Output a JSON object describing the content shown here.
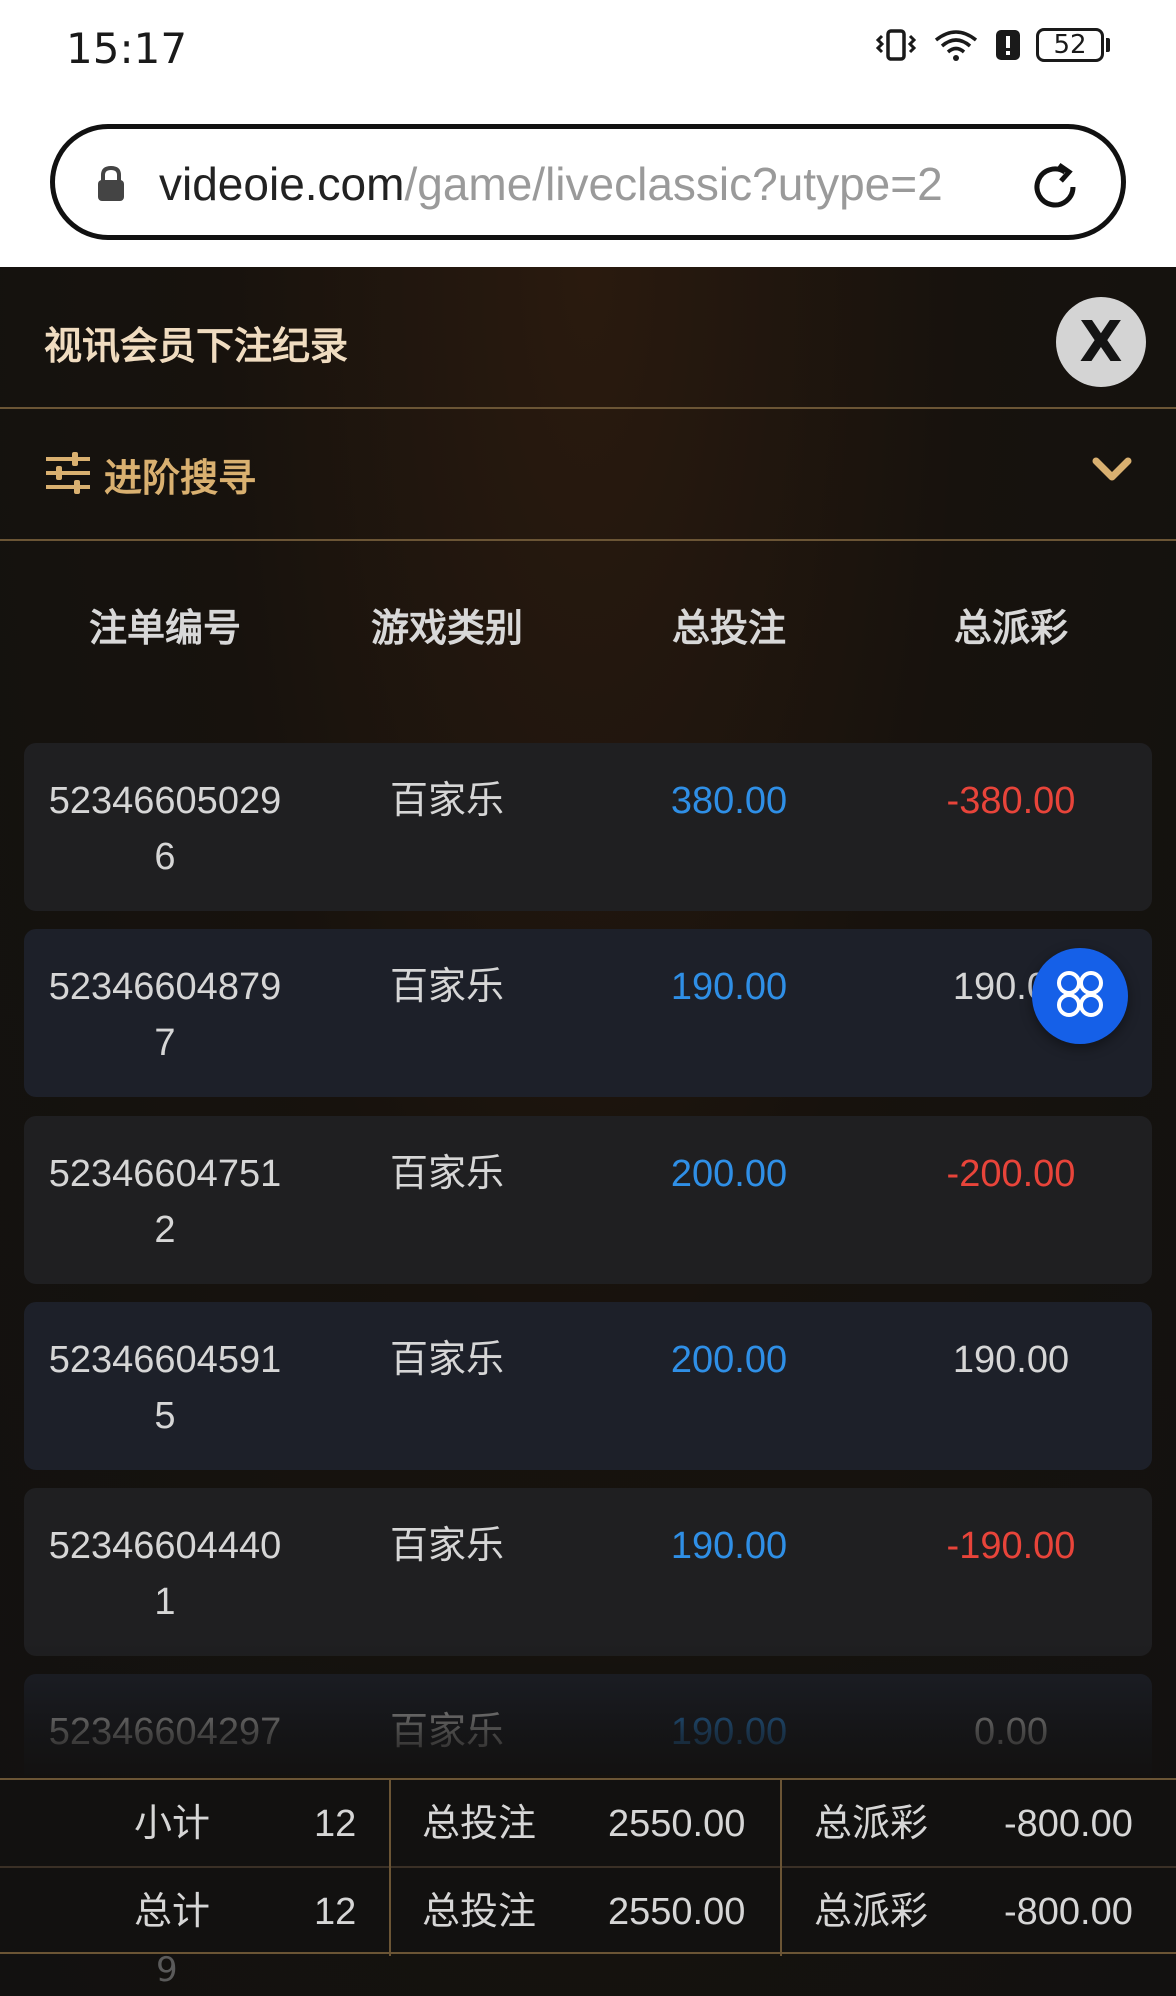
{
  "status_bar": {
    "time": "15:17",
    "battery": "52"
  },
  "browser": {
    "url_host": "videoie.com",
    "url_path": "/game/liveclassic?utype=2"
  },
  "panel": {
    "title": "视讯会员下注纪录",
    "close_label": "X",
    "advanced_search_label": "进阶搜寻"
  },
  "table": {
    "headers": [
      "注单编号",
      "游戏类别",
      "总投注",
      "总派彩"
    ],
    "rows": [
      {
        "id_line1": "52346605029",
        "id_line2": "6",
        "game": "百家乐",
        "bet": "380.00",
        "payout": "-380.00"
      },
      {
        "id_line1": "52346604879",
        "id_line2": "7",
        "game": "百家乐",
        "bet": "190.00",
        "payout": "190.00"
      },
      {
        "id_line1": "52346604751",
        "id_line2": "2",
        "game": "百家乐",
        "bet": "200.00",
        "payout": "-200.00"
      },
      {
        "id_line1": "52346604591",
        "id_line2": "5",
        "game": "百家乐",
        "bet": "200.00",
        "payout": "190.00"
      },
      {
        "id_line1": "52346604440",
        "id_line2": "1",
        "game": "百家乐",
        "bet": "190.00",
        "payout": "-190.00"
      },
      {
        "id_line1": "52346604297",
        "id_line2": "9",
        "game": "百家乐",
        "bet": "190.00",
        "payout": "0.00"
      }
    ]
  },
  "summary": {
    "subtotal": {
      "label": "小计",
      "count": "12",
      "bet_label": "总投注",
      "bet": "2550.00",
      "payout_label": "总派彩",
      "payout": "-800.00"
    },
    "total": {
      "label": "总计",
      "count": "12",
      "bet_label": "总投注",
      "bet": "2550.00",
      "payout_label": "总派彩",
      "payout": "-800.00"
    }
  },
  "colors": {
    "accent_gold": "#d9b070",
    "bet_blue": "#2f8fe6",
    "loss_red": "#e8443a",
    "float_button": "#1560e8"
  },
  "icons": {
    "lock": "lock-icon",
    "reload": "reload-icon",
    "filter": "sliders-icon",
    "chevron": "chevron-down-icon",
    "float": "menu-grid-icon"
  }
}
